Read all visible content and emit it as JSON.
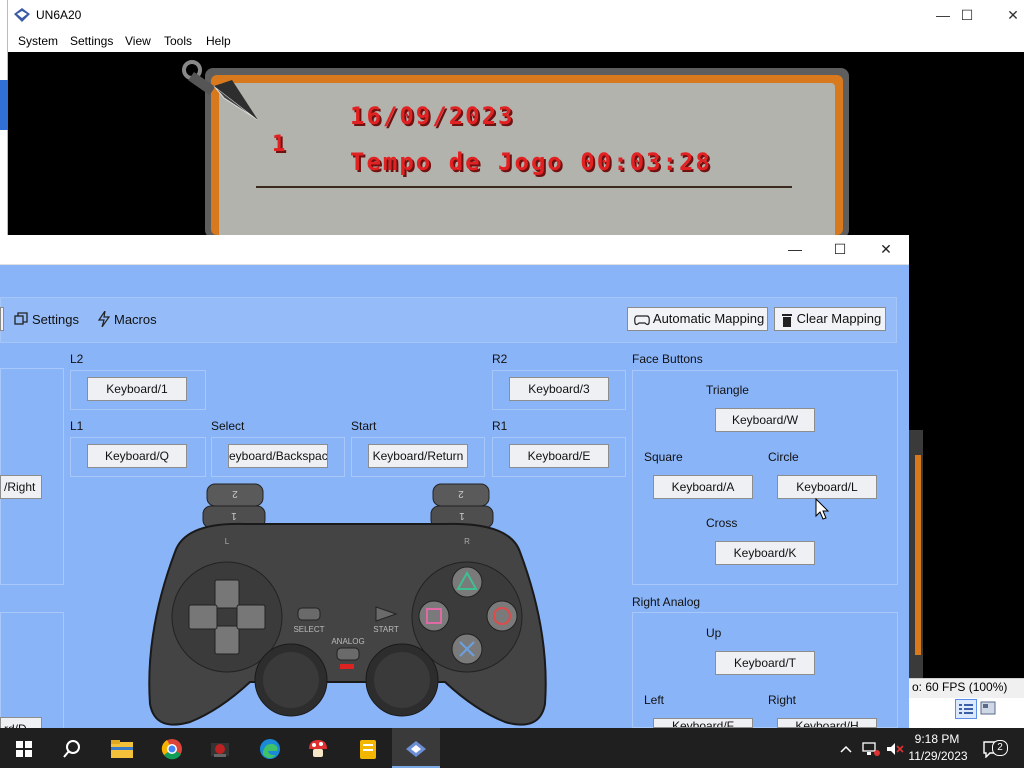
{
  "emulator": {
    "title": "UN6A20",
    "menu": [
      "System",
      "Settings",
      "View",
      "Tools",
      "Help"
    ],
    "window_controls": {
      "minimize": "—",
      "maximize": "☐",
      "close": "✕"
    },
    "game": {
      "date": "16/09/2023",
      "slot": "1",
      "play_time": "Tempo de Jogo 00:03:28"
    },
    "status_fps": "o: 60 FPS (100%)"
  },
  "controller": {
    "window_controls": {
      "minimize": "—",
      "maximize": "☐",
      "close": "✕"
    },
    "toolbar": {
      "settings_label": "Settings",
      "macros_label": "Macros",
      "auto_mapping_label": "Automatic Mapping",
      "clear_mapping_label": "Clear Mapping"
    },
    "bindings": {
      "l2": {
        "label": "L2",
        "value": "Keyboard/1"
      },
      "l1": {
        "label": "L1",
        "value": "Keyboard/Q"
      },
      "r2": {
        "label": "R2",
        "value": "Keyboard/3"
      },
      "r1": {
        "label": "R1",
        "value": "Keyboard/E"
      },
      "select": {
        "label": "Select",
        "value": "eyboard/Backspac"
      },
      "start": {
        "label": "Start",
        "value": "Keyboard/Return"
      },
      "dpad_right": {
        "value": "/Right"
      },
      "lower_left": {
        "value": "rd/D"
      }
    },
    "face_buttons": {
      "title": "Face Buttons",
      "triangle": {
        "label": "Triangle",
        "value": "Keyboard/W"
      },
      "square": {
        "label": "Square",
        "value": "Keyboard/A"
      },
      "circle": {
        "label": "Circle",
        "value": "Keyboard/L"
      },
      "cross": {
        "label": "Cross",
        "value": "Keyboard/K"
      }
    },
    "right_analog": {
      "title": "Right Analog",
      "up": {
        "label": "Up",
        "value": "Keyboard/T"
      },
      "left": {
        "label": "Left",
        "value": "Keyboard/F"
      },
      "right": {
        "label": "Right",
        "value": "Keyboard/H"
      }
    },
    "gamepad": {
      "l1": "1",
      "l2": "2",
      "r1": "1",
      "r2": "2",
      "l": "L",
      "r": "R",
      "select": "SELECT",
      "start": "START",
      "analog": "ANALOG"
    }
  },
  "taskbar": {
    "icons": [
      "windows-start",
      "search",
      "file-explorer",
      "chrome",
      "game-app",
      "edge",
      "mushroom-app",
      "notes-app",
      "emulator-app"
    ],
    "clock_time": "9:18 PM",
    "clock_date": "11/29/2023",
    "notification_count": "2"
  }
}
